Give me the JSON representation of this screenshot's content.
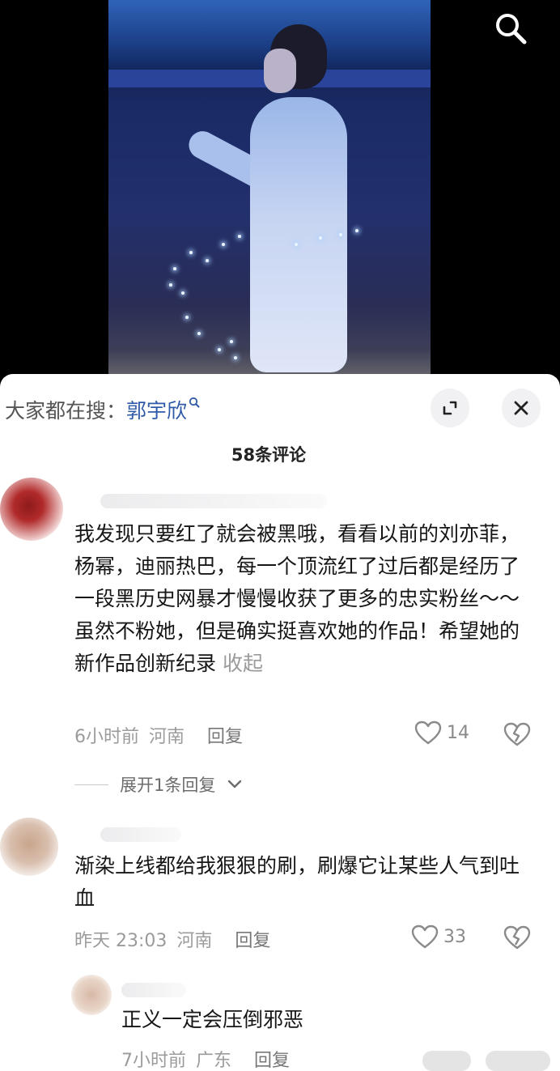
{
  "header": {
    "search_icon": "search-icon"
  },
  "trending": {
    "prefix": "大家都在搜：",
    "term": "郭宇欣"
  },
  "sheet": {
    "comment_count": "58条评论",
    "expand_icon": "expand-icon",
    "close_icon": "close-icon"
  },
  "comments": [
    {
      "text": "我发现只要红了就会被黑哦，看看以前的刘亦菲，杨幂，迪丽热巴，每一个顶流红了过后都是经历了一段黑历史网暴才慢慢收获了更多的忠实粉丝～～虽然不粉她，但是确实挺喜欢她的作品！希望她的新作品创新纪录",
      "collapse_label": "收起",
      "time": "6小时前",
      "location": "河南",
      "reply_label": "回复",
      "likes": "14",
      "expand_replies": "展开1条回复"
    },
    {
      "text": "渐染上线都给我狠狠的刷，刷爆它让某些人气到吐血",
      "time": "昨天 23:03",
      "location": "河南",
      "reply_label": "回复",
      "likes": "33"
    },
    {
      "text": "正义一定会压倒邪恶",
      "time": "7小时前",
      "location": "广东",
      "reply_label": "回复"
    }
  ],
  "colors": {
    "link": "#2f5aa8",
    "meta": "#9b9b9b",
    "sheet_bg": "#ffffff",
    "button_bg": "#f1f1f3"
  }
}
